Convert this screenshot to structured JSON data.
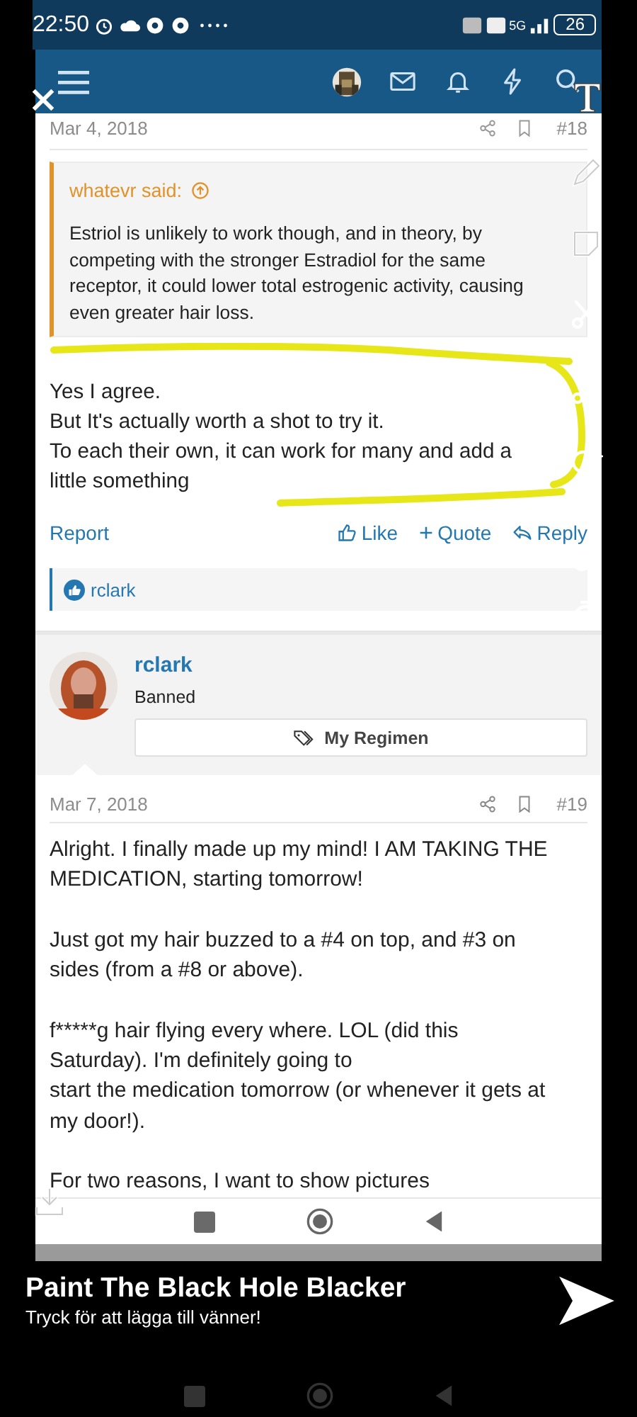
{
  "status_bar": {
    "time": "22:50",
    "network": "5G",
    "battery": "26"
  },
  "post_18": {
    "date": "Mar 4, 2018",
    "number": "#18",
    "quote": {
      "attribution": "whatevr said:",
      "text": [
        "Estriol is unlikely to work though, and in theory, by",
        "competing with the stronger Estradiol for the same",
        "receptor, it could lower total estrogenic activity, causing",
        "even greater hair loss."
      ]
    },
    "message": [
      "Yes I agree.",
      "But It's actually worth a shot to try it.",
      "To each their own, it can work for many and add a",
      "little something"
    ],
    "actions": {
      "report": "Report",
      "like": "Like",
      "quote": "Quote",
      "reply": "Reply"
    },
    "reaction_user": "rclark"
  },
  "post_19": {
    "user": "rclark",
    "role": "Banned",
    "regimen_button": "My Regimen",
    "date": "Mar 7, 2018",
    "number": "#19",
    "paragraphs": [
      [
        "Alright. I finally made up my mind! I AM TAKING THE",
        "MEDICATION, starting tomorrow!"
      ],
      [
        "Just got my hair buzzed to a #4 on top, and #3 on",
        "sides (from a #8 or above)."
      ],
      [
        "f*****g hair flying every where. LOL (did this",
        "Saturday). I'm definitely going to",
        "start the medication tomorrow (or whenever it gets at",
        "my door!)."
      ],
      [
        "For two reasons, I want to show pictures"
      ]
    ]
  },
  "snap_caption": {
    "title": "Paint The Black Hole Blacker",
    "subtitle": "Tryck för att lägga till vänner!"
  }
}
